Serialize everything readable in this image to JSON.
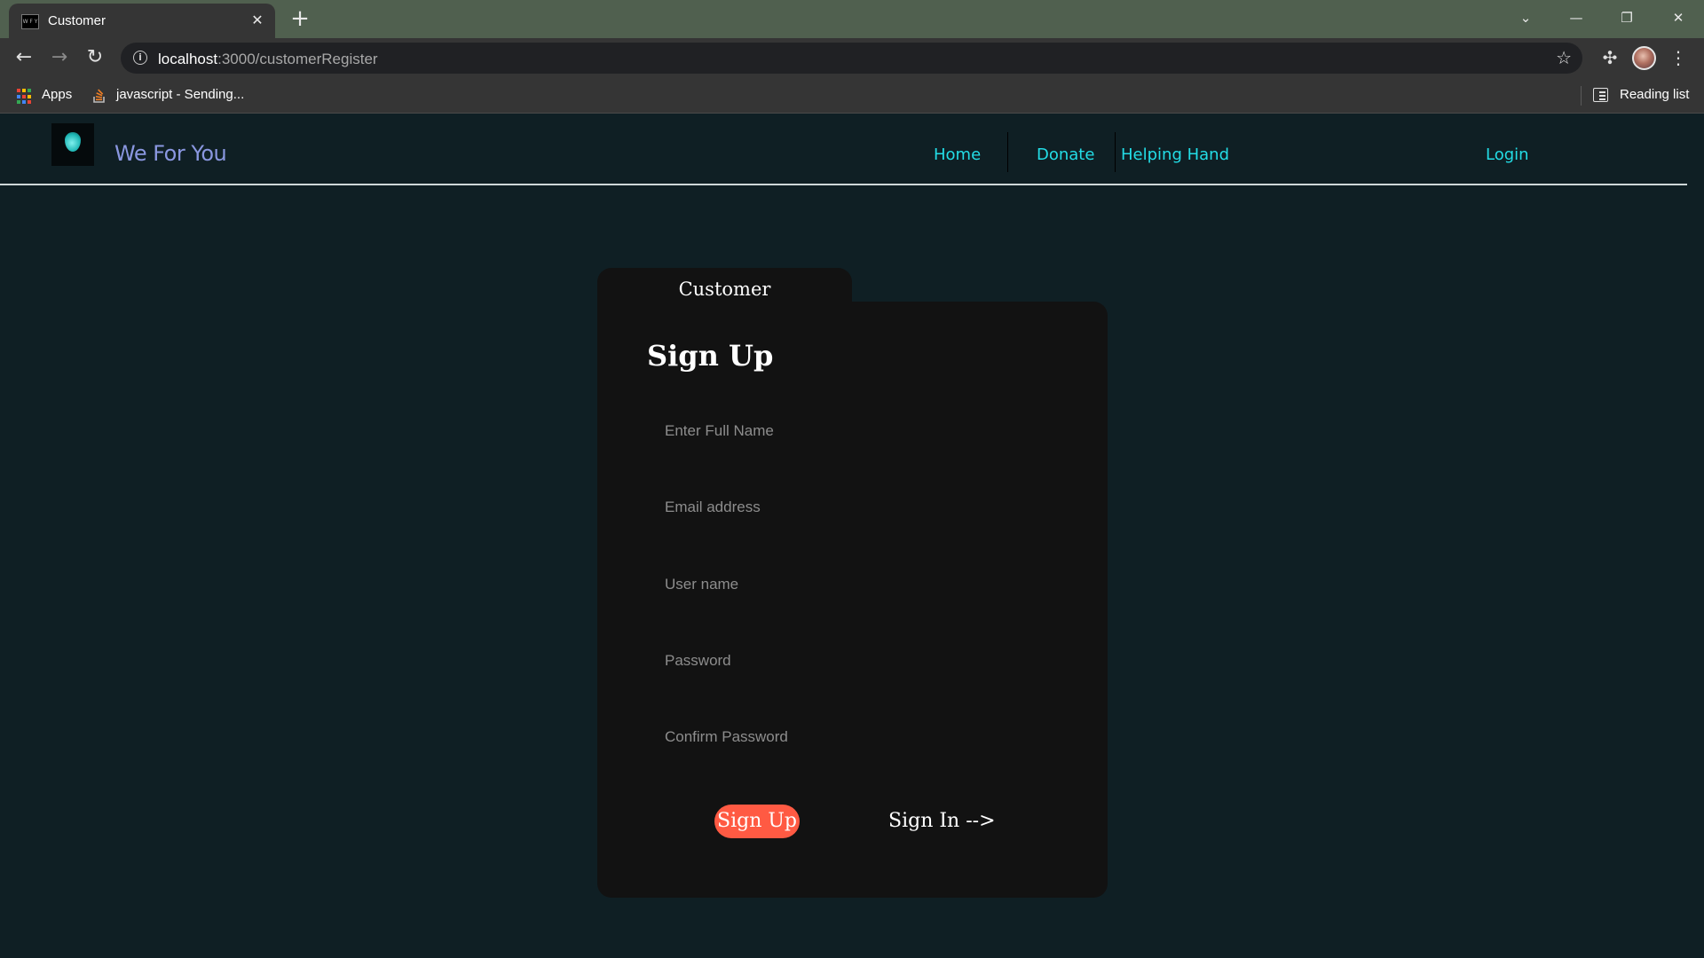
{
  "browser": {
    "tab_title": "Customer",
    "favicon_text": "W F Y",
    "url_host": "localhost",
    "url_path": ":3000/customerRegister",
    "bookmarks": [
      {
        "label": "Apps",
        "icon": "apps-grid-icon"
      },
      {
        "label": "javascript - Sending...",
        "icon": "stackoverflow-icon"
      }
    ],
    "reading_list_label": "Reading list"
  },
  "navbar": {
    "brand": "We For You",
    "links": [
      "Home",
      "Donate",
      "Helping Hand"
    ],
    "login": "Login"
  },
  "form": {
    "tab_label": "Customer",
    "title": "Sign Up",
    "fields": [
      {
        "placeholder": "Enter Full Name",
        "type": "text"
      },
      {
        "placeholder": "Email address",
        "type": "email"
      },
      {
        "placeholder": "User name",
        "type": "text"
      },
      {
        "placeholder": "Password",
        "type": "password"
      },
      {
        "placeholder": "Confirm Password",
        "type": "password"
      }
    ],
    "submit_label": "Sign Up",
    "signin_label": "Sign In -->"
  },
  "colors": {
    "page_bg": "#0f1f24",
    "card_bg": "#121212",
    "accent": "#ff5a43",
    "nav_link": "#23dde6",
    "brand": "#8a97e0"
  }
}
